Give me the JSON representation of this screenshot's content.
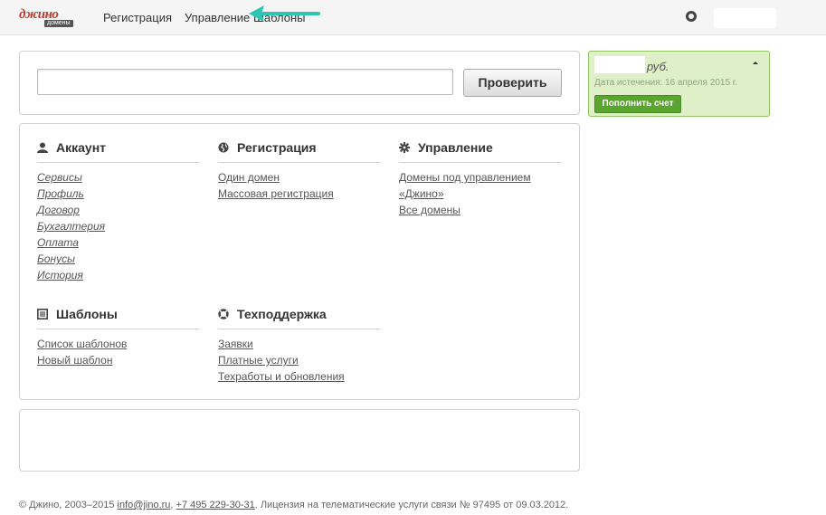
{
  "logo": {
    "main": "джино",
    "sub": "домены"
  },
  "nav": {
    "registration": "Регистрация",
    "management": "Управление",
    "templates": "Шаблоны"
  },
  "search": {
    "value": "",
    "placeholder": "",
    "button": "Проверить"
  },
  "sections": {
    "account": {
      "title": "Аккаунт",
      "links": [
        "Сервисы",
        "Профиль",
        "Договор",
        "Бухгалтерия",
        "Оплата",
        "Бонусы",
        "История"
      ]
    },
    "registration": {
      "title": "Регистрация",
      "links": [
        "Один домен",
        "Массовая регистрация"
      ]
    },
    "management": {
      "title": "Управление",
      "links": [
        "Домены под управлением «Джино»",
        "Все домены"
      ]
    },
    "templates": {
      "title": "Шаблоны",
      "links": [
        "Список шаблонов",
        "Новый шаблон"
      ]
    },
    "support": {
      "title": "Техподдержка",
      "links": [
        "Заявки",
        "Платные услуги",
        "Техработы и обновления"
      ]
    }
  },
  "balance": {
    "currency": "руб.",
    "expiry": "Дата истечения: 16 апреля 2015 г.",
    "topup": "Пополнить счет"
  },
  "footer": {
    "copyright": "© Джино, 2003–2015",
    "email": "info@jino.ru",
    "phone": "+7 495 229-30-31",
    "license": ". Лицензия на телематические услуги связи № 97495 от 09.03.2012."
  },
  "colors": {
    "accent_green": "#5aa52e",
    "balance_bg": "#dff0c9",
    "arrow": "#2cc6b4",
    "logo_red": "#c0392b"
  }
}
